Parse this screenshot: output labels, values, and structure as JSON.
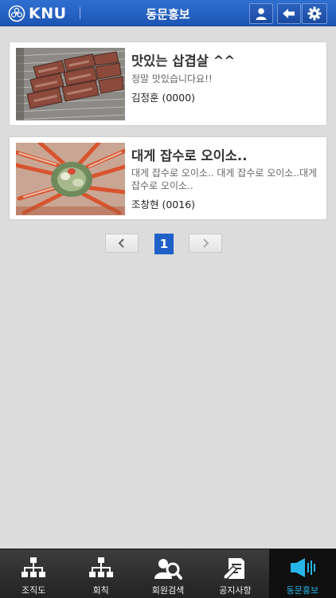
{
  "header": {
    "logo_text": "KNU",
    "title": "동문홍보"
  },
  "icons": {
    "header": [
      "user-icon",
      "back-arrow-icon",
      "gear-icon"
    ],
    "tabbar": [
      "org-chart-icon",
      "rules-icon",
      "member-search-icon",
      "notice-icon",
      "megaphone-icon"
    ]
  },
  "posts": [
    {
      "title": "맛있는 삽겹살 ^^",
      "description": "정말 맛있습니다요!!",
      "author": "김정훈 (0000)",
      "image": "grilled-pork-photo"
    },
    {
      "title": "대게 잡수로 오이소..",
      "description": "대게 잡수로 오이소.. 대게 잡수로 오이소..대게 잡수로 오이소..",
      "author": "조창현 (0016)",
      "image": "snow-crab-photo"
    }
  ],
  "pagination": {
    "current_page": "1",
    "prev_glyph": "‹",
    "next_glyph": "›"
  },
  "tabbar": {
    "tabs": [
      {
        "label": "조직도",
        "active": false
      },
      {
        "label": "회칙",
        "active": false
      },
      {
        "label": "회원검색",
        "active": false
      },
      {
        "label": "공지사항",
        "active": false
      },
      {
        "label": "동문홍보",
        "active": true
      }
    ]
  },
  "colors": {
    "header_blue": "#1d56b5",
    "accent_blue": "#1f61c9",
    "active_tab_text": "#27b4e6",
    "background": "#dcdcdc"
  }
}
